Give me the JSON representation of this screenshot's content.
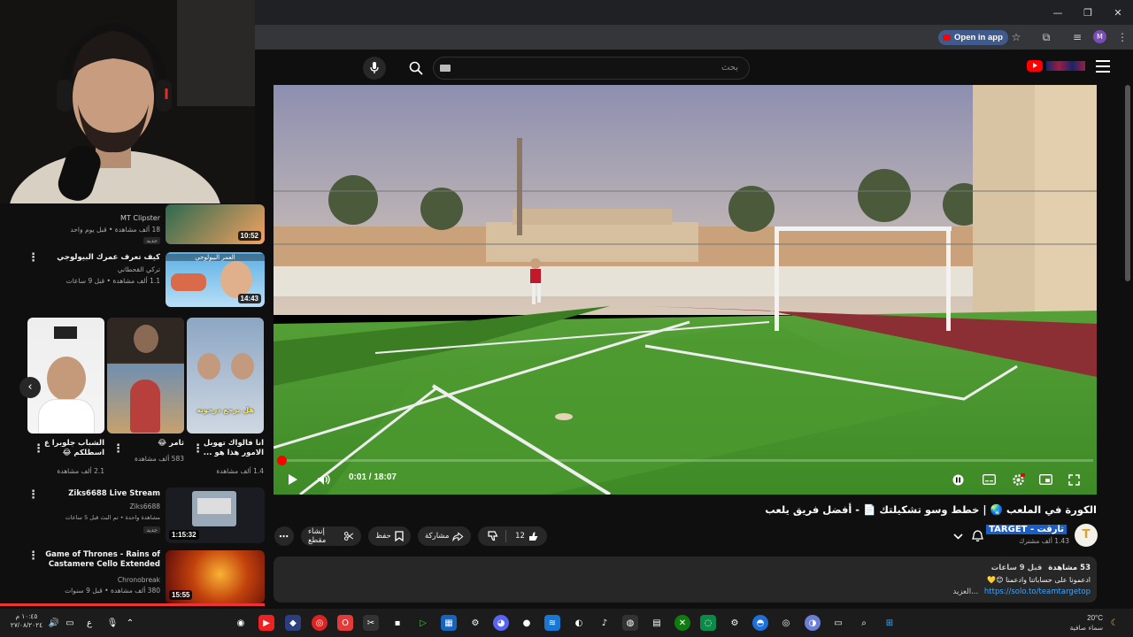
{
  "browser": {
    "open_in_app": "Open in app",
    "profile_initial": "M"
  },
  "header": {
    "search_placeholder": "بحث"
  },
  "player": {
    "time_current": "0:01",
    "time_separator": " / ",
    "time_total": "18:07",
    "progress": 0.001
  },
  "video": {
    "title": "الكورة في الملعب 🌏 | خطط وسو تشكيلتك 📄 - أفضل فريق يلعب",
    "channel_initial": "T",
    "channel_name": "تارقت - TARGET",
    "subscribers": "1.43 ألف مشترك",
    "likes": "12",
    "share_label": "مشاركة",
    "save_label": "حفظ",
    "clip_label": "إنشاء مقطع",
    "views": "53 مشاهدة",
    "time_ago": "قبل 9 ساعات",
    "desc_line1": "ادعمونا على حساباتنا وادعمنا 😊💛",
    "desc_more": "...العزيد",
    "desc_link": "https://solo.to/teamtargetop"
  },
  "sidebar": {
    "top_item": {
      "channel": "MT Clipster",
      "meta": "18 ألف مشاهدة • قبل يوم واحد",
      "badge": "جديد",
      "duration": "10:52"
    },
    "item2": {
      "title": "كيف تعرف عمرك البيولوجي",
      "channel": "تركي القحطاني",
      "meta": "1.1 ألف مشاهدة • قبل 9 ساعات",
      "badge": "جديد",
      "duration": "14:43",
      "thumb_caption": "العمر البيولوجي"
    },
    "shorts": [
      {
        "title": "الشباب جلوبرا ع اسطلكم 😂",
        "views": "2.1 ألف مشاهدة"
      },
      {
        "title": "ثامر 😂",
        "views": "583 ألف مشاهدة"
      },
      {
        "title": "انا فالواك تهوبل الامور هذا هو ...",
        "views": "1.4 ألف مشاهدة"
      }
    ],
    "short3_caption": "هل يرجع درجونه",
    "item3": {
      "title": "Ziks6688 Live Stream",
      "channel": "Ziks6688",
      "meta": "مشاهدة واحدة • تم البث قبل 5 ساعات",
      "badge": "جديد",
      "duration": "1:15:32"
    },
    "item4": {
      "title": "Game of Thrones - Rains of Castamere Cello Extended",
      "channel": "Chronobreak",
      "meta": "380 ألف مشاهدة • قبل 9 سنوات",
      "duration": "15:55"
    }
  },
  "taskbar": {
    "time": "١٠:٤٥ م",
    "date": "٢٧/٠٨/٢٠٢٤",
    "lang": "ع",
    "weather_temp": "20°C",
    "weather_desc": "سماء صافية"
  },
  "colors": {
    "accent_red": "#ff0000",
    "link_blue": "#3ea6ff",
    "selection_blue": "#1a5fc6"
  }
}
